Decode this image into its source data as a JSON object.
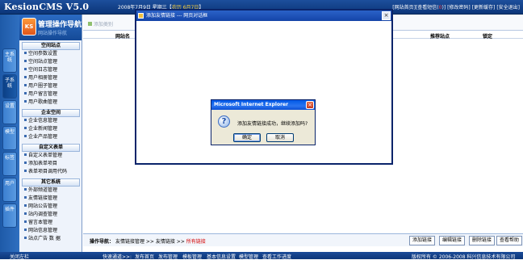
{
  "app": {
    "brand": "KesionCMS V5.0",
    "date_prefix": "2008年7月9日 星期三【",
    "lunar": "农历 6月7日",
    "date_suffix": "】",
    "links": [
      {
        "label": "[网站首页]"
      },
      {
        "label": "[查看短信("
      },
      {
        "label": "0"
      },
      {
        "label": ")]"
      },
      {
        "label": "[修改密码]"
      },
      {
        "label": "[更新缓存]"
      },
      {
        "label": "[安全退出]"
      }
    ]
  },
  "vtabs": [
    {
      "label": "主系统"
    },
    {
      "label": "子系统"
    },
    {
      "label": "设置"
    },
    {
      "label": "模型"
    },
    {
      "label": "标签"
    },
    {
      "label": "用户"
    },
    {
      "label": "插件"
    }
  ],
  "sidebar": {
    "logo_mark": "KS",
    "logo_title": "管理操作导航",
    "logo_sub": "网站操作导航",
    "sections": [
      {
        "title": "空间站点",
        "items": [
          "空间参数设置",
          "空间站点管理",
          "空间日志管理",
          "用户相册管理",
          "用户圈子管理",
          "用户留言管理",
          "用户歌曲管理"
        ]
      },
      {
        "title": "企业空间",
        "items": [
          "企业信息管理",
          "企业新闻管理",
          "企业产品管理"
        ]
      },
      {
        "title": "自定义表单",
        "items": [
          "自定义表单管理",
          "添加表单项目",
          "表单项目调用代码"
        ]
      },
      {
        "title": "其它系统",
        "items": [
          "外部频道管理",
          "友情链接管理",
          "网站公告管理",
          "站内调查管理",
          "留言本管理",
          "网站信息管理",
          "站点广告 数 据"
        ]
      }
    ]
  },
  "content": {
    "toolbar_add": "添加类别",
    "headers": {
      "name": "网站名",
      "recommend": "推荐站点",
      "lock": "锁定"
    }
  },
  "bottom": {
    "crumb_label": "操作导航：",
    "crumb_1": "友情链接管理",
    "sep": ">>",
    "crumb_2": "友情链接",
    "crumb_3": "所有链接",
    "buttons": [
      "添加链接",
      "编辑链接",
      "删除链接",
      "查看帮助"
    ]
  },
  "footer": {
    "left": "关闭左栏",
    "quick": "快速通道>>:",
    "links": [
      "发布首页",
      "发布管理",
      "模板管理",
      "基本信息设置",
      "模型管理",
      "查看工作进度"
    ],
    "copyright": "版权所有 © 2006-2008  科兴信息技术有限公司"
  },
  "popup": {
    "title": "添加友情链接 --- 网页对话框",
    "close": "×"
  },
  "msgbox": {
    "title": "Microsoft Internet Explorer",
    "close": "×",
    "icon": "?",
    "text": "添加友情链接成功，继续添加吗?",
    "ok": "确定",
    "cancel": "取消"
  }
}
